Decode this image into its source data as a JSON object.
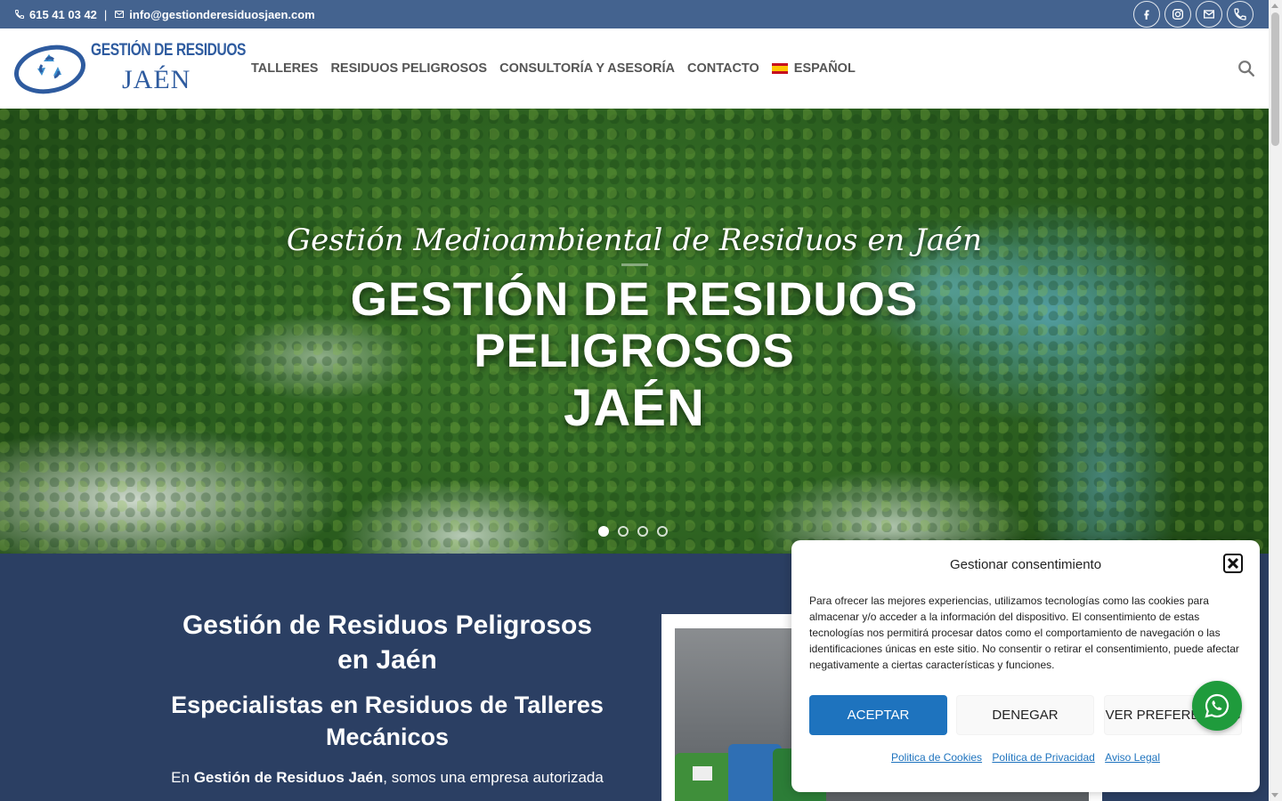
{
  "topbar": {
    "phone": "615 41 03 42",
    "separator": "|",
    "email": "info@gestionderesiduosjaen.com",
    "social_icons": [
      "facebook-icon",
      "instagram-icon",
      "envelope-icon",
      "phone-icon"
    ]
  },
  "header": {
    "logo_line1": "GESTIÓN DE RESIDUOS",
    "logo_line2": "JAÉN",
    "nav": [
      "TALLERES",
      "RESIDUOS PELIGROSOS",
      "CONSULTORÍA Y ASESORÍA",
      "CONTACTO"
    ],
    "language": "ESPAÑOL"
  },
  "hero": {
    "subtitle": "Gestión Medioambiental de Residuos en Jaén",
    "title_line1": "GESTIÓN DE RESIDUOS",
    "title_line2": "PELIGROSOS",
    "title_line3": "JAÉN",
    "slides": 4,
    "active_slide": 1
  },
  "section": {
    "heading": "Gestión de Residuos Peligrosos en Jaén",
    "subheading": "Especialistas en Residuos de Talleres Mecánicos",
    "text_prefix": "En ",
    "text_bold": "Gestión de Residuos Jaén",
    "text_suffix": ", somos una empresa autorizada"
  },
  "cookie": {
    "title": "Gestionar consentimiento",
    "text": "Para ofrecer las mejores experiencias, utilizamos tecnologías como las cookies para almacenar y/o acceder a la información del dispositivo. El consentimiento de estas tecnologías nos permitirá procesar datos como el comportamiento de navegación o las identificaciones únicas en este sitio. No consentir o retirar el consentimiento, puede afectar negativamente a ciertas características y funciones.",
    "accept": "ACEPTAR",
    "deny": "DENEGAR",
    "preferences": "VER PREFERENCIAS",
    "link_cookies": "Politica de Cookies",
    "link_privacy": "Política de Privacidad",
    "link_legal": "Aviso Legal"
  },
  "colors": {
    "topbar": "#44638f",
    "accent": "#1e73be",
    "section_bg": "#2b3f63",
    "whatsapp": "#1f9b3c"
  }
}
